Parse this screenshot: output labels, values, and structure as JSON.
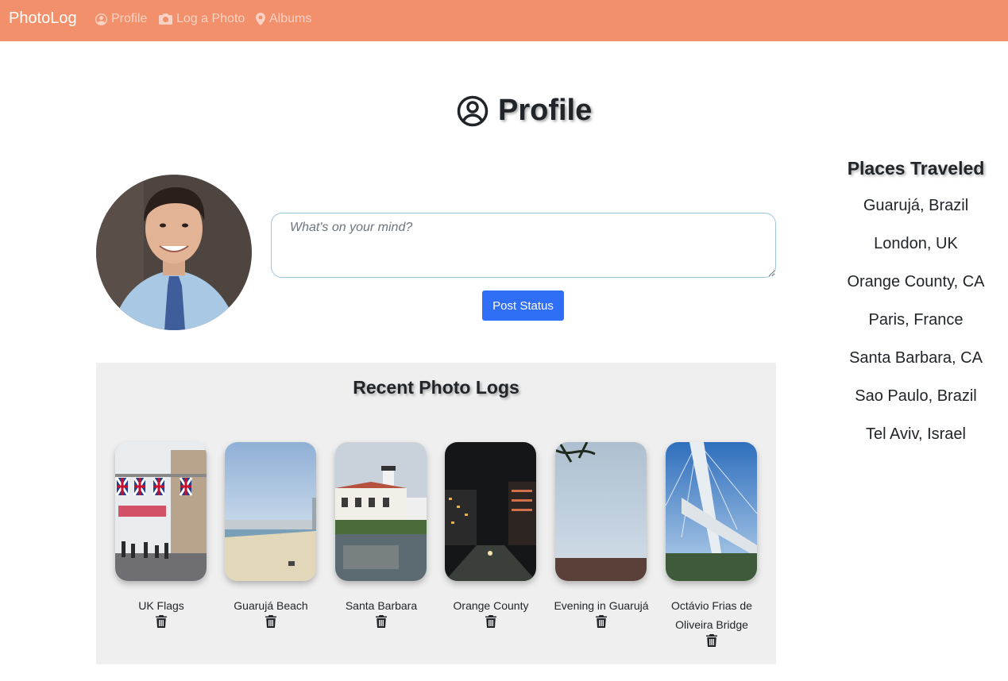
{
  "navbar": {
    "brand": "PhotoLog",
    "links": [
      {
        "label": "Profile",
        "icon": "user-circle-icon"
      },
      {
        "label": "Log a Photo",
        "icon": "camera-icon"
      },
      {
        "label": "Albums",
        "icon": "map-marker-icon"
      }
    ],
    "background": "#f2906b"
  },
  "page": {
    "title": "Profile",
    "title_icon": "user-circle-icon"
  },
  "status": {
    "placeholder": "What's on your mind?",
    "button_label": "Post Status",
    "button_color": "#2f6ef6"
  },
  "recent": {
    "title": "Recent Photo Logs",
    "photos": [
      {
        "caption": "UK Flags"
      },
      {
        "caption": "Guarujá Beach"
      },
      {
        "caption": "Santa Barbara"
      },
      {
        "caption": "Orange County"
      },
      {
        "caption": "Evening in Guarujá"
      },
      {
        "caption": "Octávio Frias de Oliveira Bridge"
      }
    ]
  },
  "places": {
    "title": "Places Traveled",
    "items": [
      "Guarujá, Brazil",
      "London, UK",
      "Orange County, CA",
      "Paris, France",
      "Santa Barbara, CA",
      "Sao Paulo, Brazil",
      "Tel Aviv, Israel"
    ]
  }
}
